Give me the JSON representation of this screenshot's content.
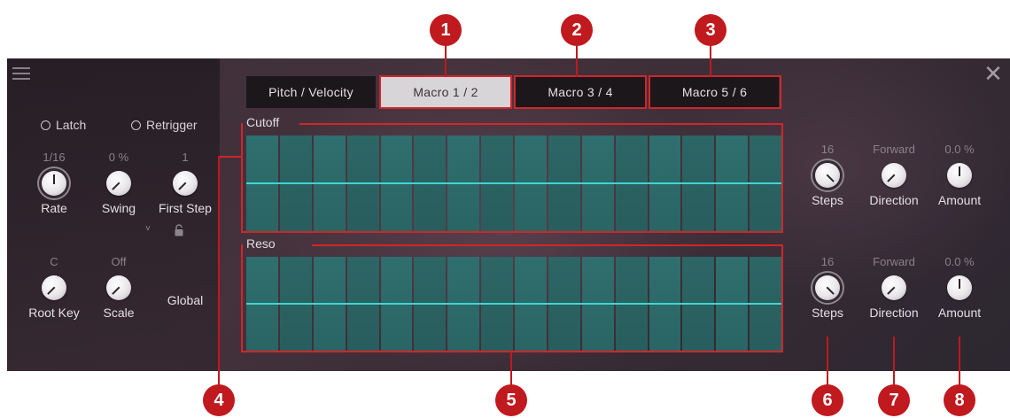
{
  "window": {
    "menu_icon": "hamburger-icon",
    "close_icon": "close-icon",
    "close_glyph": "✕"
  },
  "left_panel": {
    "latch_label": "Latch",
    "retrigger_label": "Retrigger",
    "knobs_row1": [
      {
        "value": "1/16",
        "label": "Rate"
      },
      {
        "value": "0 %",
        "label": "Swing"
      },
      {
        "value": "1",
        "label": "First Step"
      }
    ],
    "knobs_row2": [
      {
        "value": "C",
        "label": "Root Key"
      },
      {
        "value": "Off",
        "label": "Scale"
      },
      {
        "value": "",
        "label": "Global"
      }
    ],
    "scale_dropdown_glyph": "˅"
  },
  "tabs": [
    {
      "label": "Pitch / Velocity",
      "active": false
    },
    {
      "label": "Macro 1 / 2",
      "active": true
    },
    {
      "label": "Macro 3 / 4",
      "active": false
    },
    {
      "label": "Macro 5 / 6",
      "active": false
    }
  ],
  "lanes": [
    {
      "name": "Cutoff",
      "steps_value": "16",
      "steps_label": "Steps",
      "direction_value": "Forward",
      "direction_label": "Direction",
      "amount_value": "0.0 %",
      "amount_label": "Amount"
    },
    {
      "name": "Reso",
      "steps_value": "16",
      "steps_label": "Steps",
      "direction_value": "Forward",
      "direction_label": "Direction",
      "amount_value": "0.0 %",
      "amount_label": "Amount"
    }
  ],
  "step_count": 16,
  "callouts": [
    "1",
    "2",
    "3",
    "4",
    "5",
    "6",
    "7",
    "8"
  ],
  "colors": {
    "accent_red": "#c0191e",
    "step_teal": "#2f6c6b",
    "lane_line_cyan": "#3ed6d2",
    "active_tab": "#d7d5d8"
  }
}
